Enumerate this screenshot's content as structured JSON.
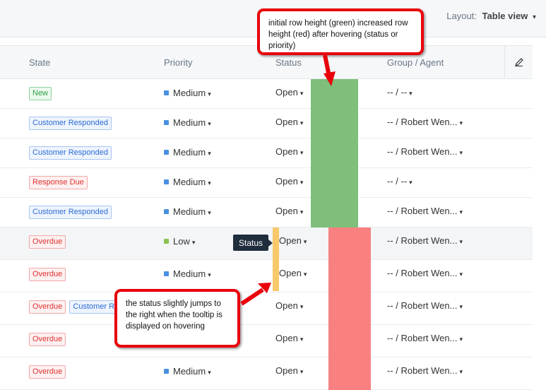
{
  "topbar": {
    "layout_label": "Layout:",
    "layout_value": "Table view"
  },
  "columns": {
    "state": "State",
    "priority": "Priority",
    "status": "Status",
    "group_agent": "Group / Agent"
  },
  "rows": [
    {
      "state": [
        "New"
      ],
      "state_types": [
        "new"
      ],
      "priority": "Medium",
      "priority_color": "#4a90e2",
      "status": "Open",
      "agent": "-- / --"
    },
    {
      "state": [
        "Customer Responded"
      ],
      "state_types": [
        "cr"
      ],
      "priority": "Medium",
      "priority_color": "#4a90e2",
      "status": "Open",
      "agent": "-- / Robert Wen..."
    },
    {
      "state": [
        "Customer Responded"
      ],
      "state_types": [
        "cr"
      ],
      "priority": "Medium",
      "priority_color": "#4a90e2",
      "status": "Open",
      "agent": "-- / Robert Wen..."
    },
    {
      "state": [
        "Response Due"
      ],
      "state_types": [
        "red"
      ],
      "priority": "Medium",
      "priority_color": "#4a90e2",
      "status": "Open",
      "agent": "-- / --"
    },
    {
      "state": [
        "Customer Responded"
      ],
      "state_types": [
        "cr"
      ],
      "priority": "Medium",
      "priority_color": "#4a90e2",
      "status": "Open",
      "agent": "-- / Robert Wen..."
    },
    {
      "state": [
        "Overdue"
      ],
      "state_types": [
        "red"
      ],
      "priority": "Low",
      "priority_color": "#8cc152",
      "status": "Open",
      "agent": "-- / Robert Wen..."
    },
    {
      "state": [
        "Overdue"
      ],
      "state_types": [
        "red"
      ],
      "priority": "Medium",
      "priority_color": "#4a90e2",
      "status": "Open",
      "agent": "-- / Robert Wen..."
    },
    {
      "state": [
        "Overdue",
        "Customer R"
      ],
      "state_types": [
        "red",
        "cr"
      ],
      "priority": "",
      "priority_color": "#4a90e2",
      "status": "Open",
      "agent": "-- / Robert Wen..."
    },
    {
      "state": [
        "Overdue"
      ],
      "state_types": [
        "red"
      ],
      "priority": "",
      "priority_color": "#4a90e2",
      "status": "Open",
      "agent": "-- / Robert Wen..."
    },
    {
      "state": [
        "Overdue"
      ],
      "state_types": [
        "red"
      ],
      "priority": "Medium",
      "priority_color": "#4a90e2",
      "status": "Open",
      "agent": "-- / Robert Wen..."
    }
  ],
  "tooltip": "Status",
  "annotations": {
    "top": "initial row height (green) increased row height (red) after hovering (status or priority)",
    "bottom": "the status slightly jumps to the right when the tooltip is displayed on hovering"
  },
  "colors": {
    "green_overlay": "#7fbf7a",
    "red_overlay": "#f98080",
    "yellow_overlay": "#f7c96b",
    "callout_border": "#e8000b"
  },
  "icons": {
    "chevron": "chevron-down-icon",
    "edit": "pencil-icon"
  }
}
